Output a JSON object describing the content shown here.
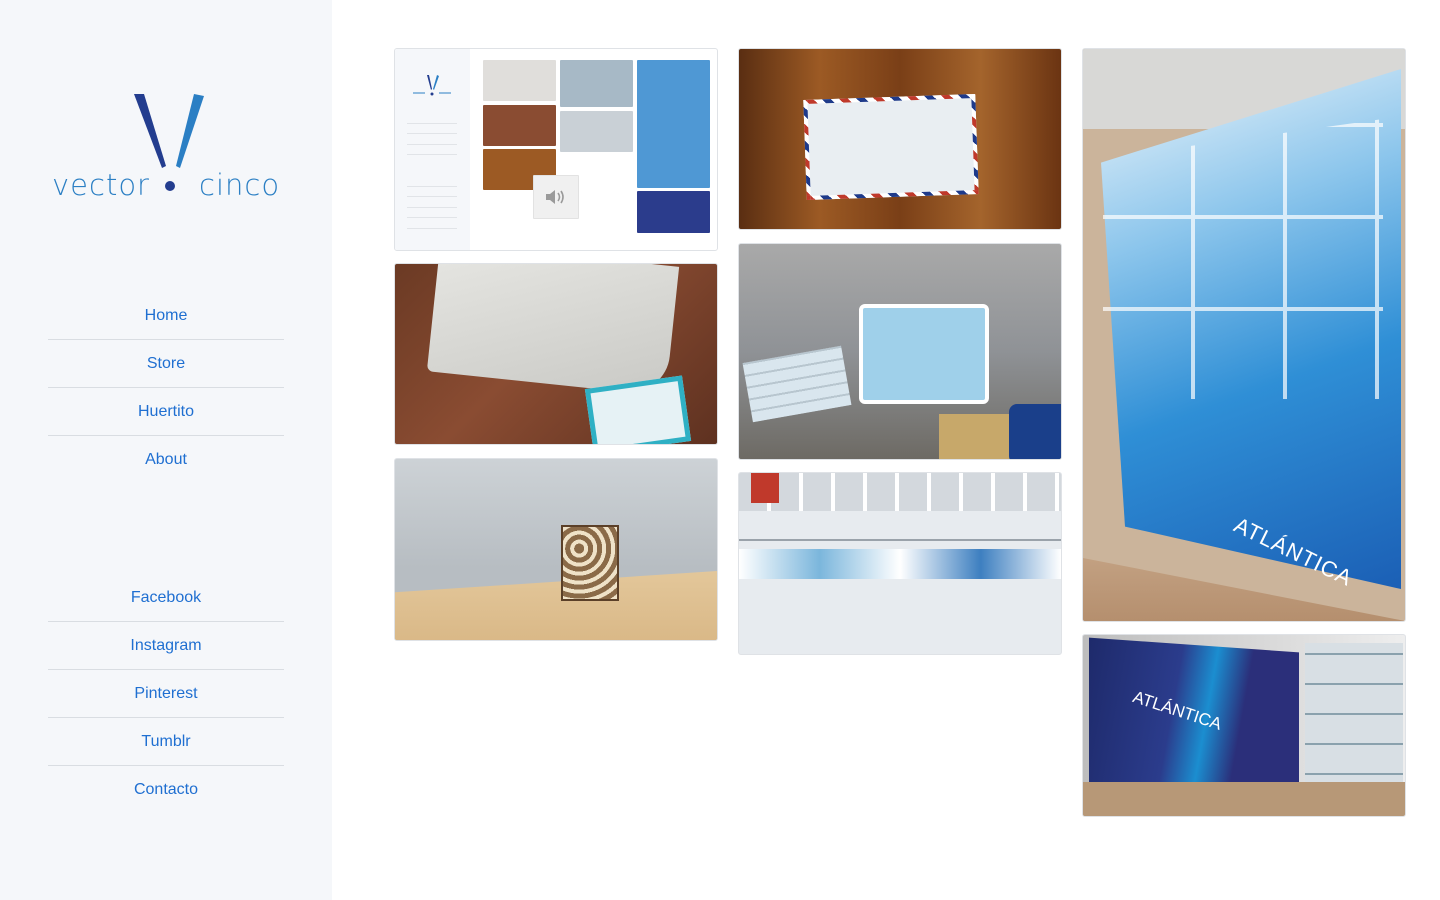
{
  "sidebar": {
    "logo": {
      "word_left": "vector",
      "word_right": "cinco"
    },
    "primary_nav": [
      {
        "label": "Home"
      },
      {
        "label": "Store"
      },
      {
        "label": "Huertito"
      },
      {
        "label": "About"
      }
    ],
    "social_nav": [
      {
        "label": "Facebook"
      },
      {
        "label": "Instagram"
      },
      {
        "label": "Pinterest"
      },
      {
        "label": "Tumblr"
      },
      {
        "label": "Contacto"
      }
    ]
  },
  "gallery": {
    "items": [
      {
        "name": "site-screenshot"
      },
      {
        "name": "envelope-sign"
      },
      {
        "name": "tablet-on-table"
      },
      {
        "name": "baby-carriage-gift"
      },
      {
        "name": "pool-building"
      },
      {
        "name": "box-lamp"
      },
      {
        "name": "swim-mural",
        "brand": "ATLÁNTICA"
      },
      {
        "name": "reception-counter",
        "brand": "ATLÁNTICA"
      }
    ]
  },
  "colors": {
    "accent": "#1f6fd1",
    "sidebar_bg": "#f5f7fa",
    "logo_blue": "#2b7fc4",
    "logo_dark": "#233d8f"
  }
}
